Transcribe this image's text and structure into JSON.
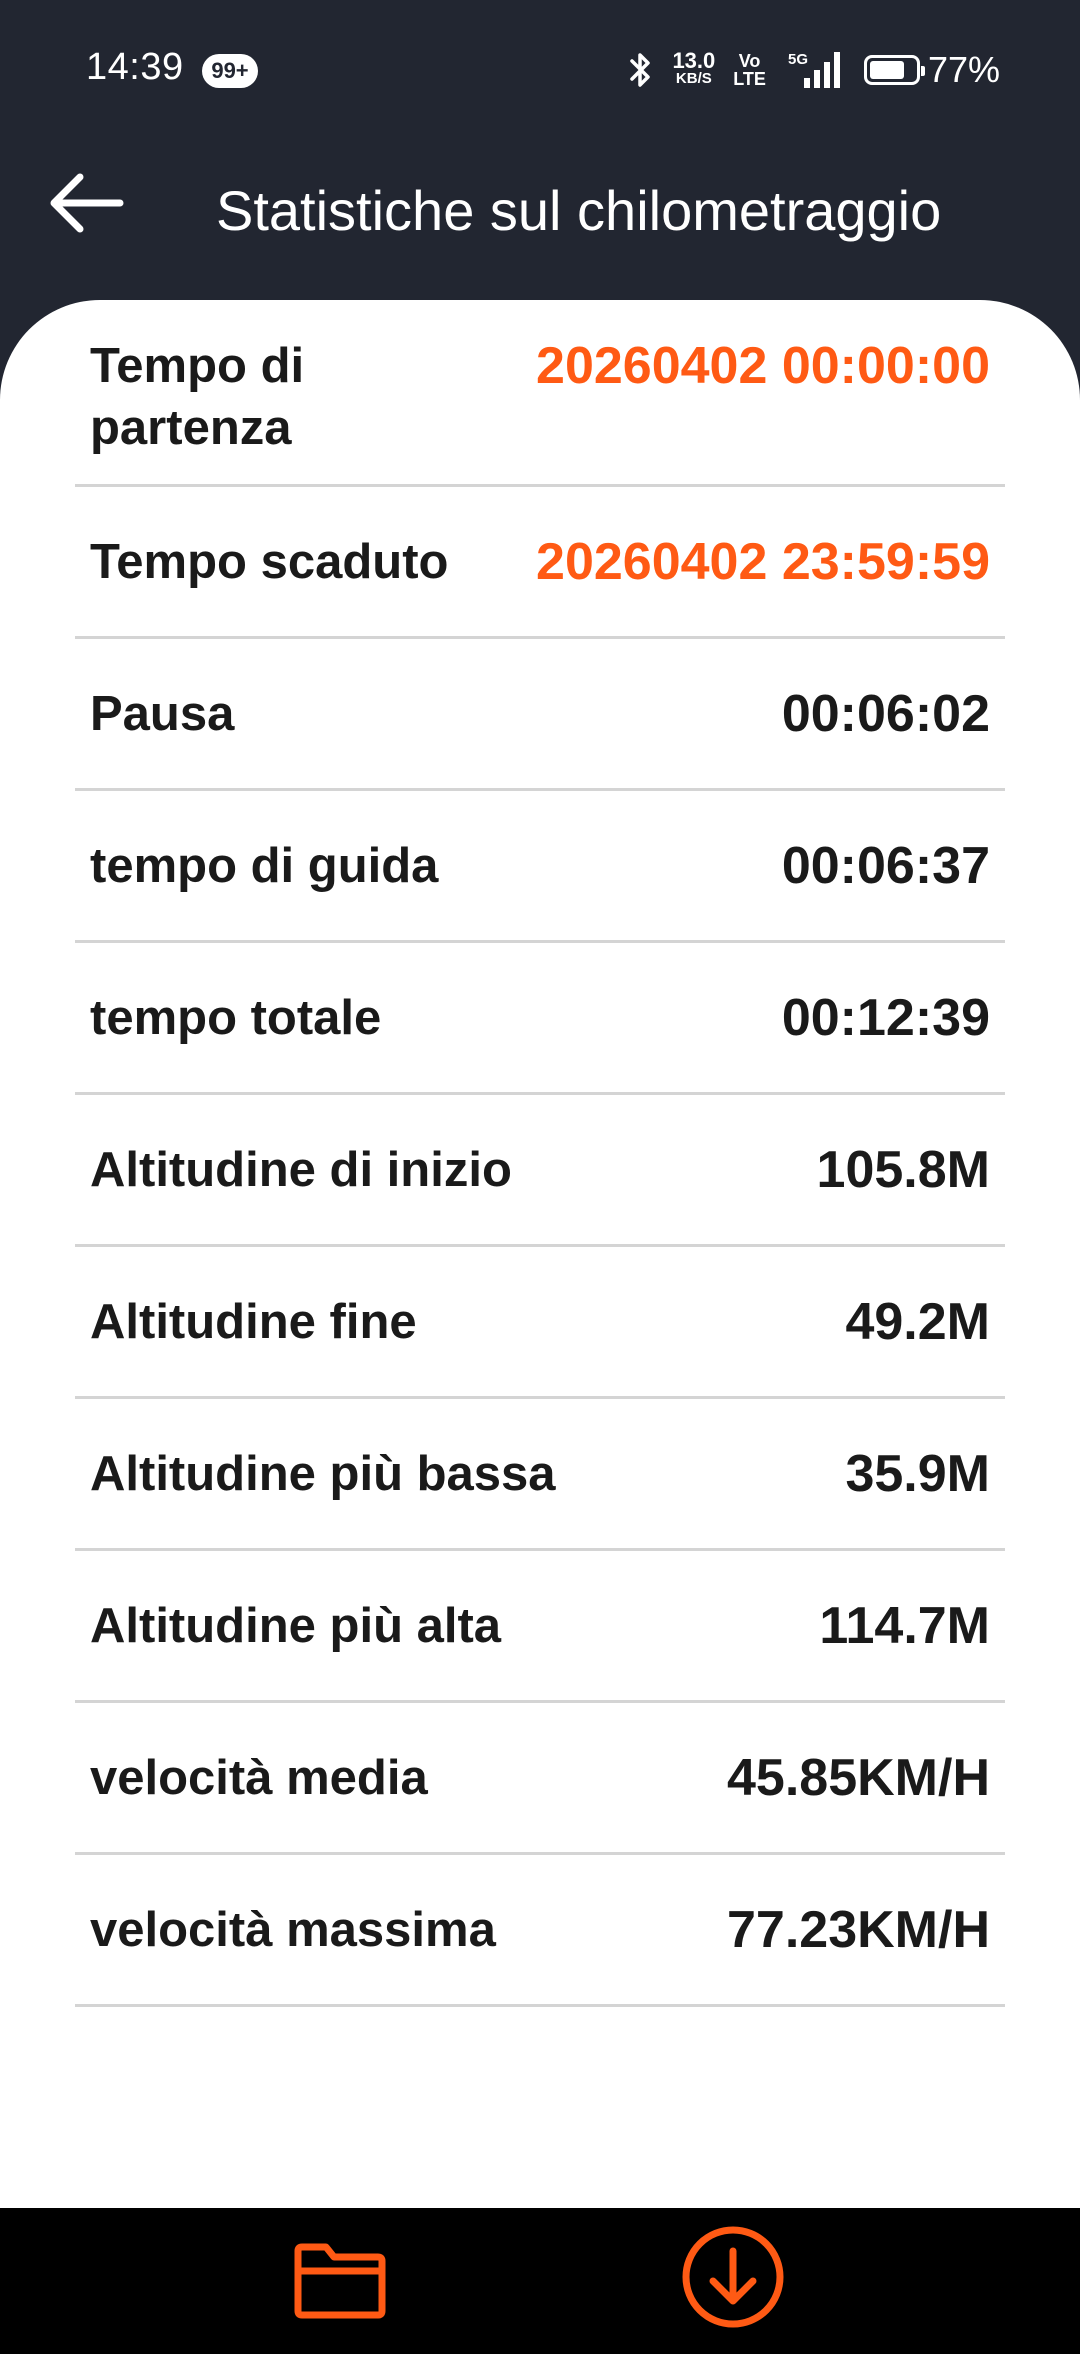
{
  "status_bar": {
    "time": "14:39",
    "notification_badge": "99+",
    "net_speed_value": "13.0",
    "net_speed_unit": "KB/S",
    "volte_top": "Vo",
    "volte_bottom": "LTE",
    "network_type": "5G",
    "battery_percent": "77%",
    "battery_level": 0.77
  },
  "header": {
    "title": "Statistiche sul chilometraggio",
    "back_icon": "arrow-left-icon"
  },
  "stats": [
    {
      "label": "Tempo di partenza",
      "value": "20260402 00:00:00",
      "accent": true
    },
    {
      "label": "Tempo scaduto",
      "value": "20260402 23:59:59",
      "accent": true
    },
    {
      "label": "Pausa",
      "value": "00:06:02",
      "accent": false
    },
    {
      "label": "tempo di guida",
      "value": "00:06:37",
      "accent": false
    },
    {
      "label": "tempo totale",
      "value": "00:12:39",
      "accent": false
    },
    {
      "label": "Altitudine di inizio",
      "value": "105.8M",
      "accent": false
    },
    {
      "label": "Altitudine fine",
      "value": "49.2M",
      "accent": false
    },
    {
      "label": "Altitudine più bassa",
      "value": "35.9M",
      "accent": false
    },
    {
      "label": "Altitudine più alta",
      "value": "114.7M",
      "accent": false
    },
    {
      "label": "velocità media",
      "value": "45.85KM/H",
      "accent": false
    },
    {
      "label": "velocità massima",
      "value": "77.23KM/H",
      "accent": false
    }
  ],
  "bottom_bar": {
    "folder_icon": "folder-icon",
    "download_icon": "download-icon"
  },
  "colors": {
    "accent": "#ff5a14",
    "header_bg": "#222631",
    "card_bg": "#ffffff",
    "text": "#1a1a1a",
    "divider": "#d4d4d4",
    "bottom_bar_bg": "#000000"
  }
}
